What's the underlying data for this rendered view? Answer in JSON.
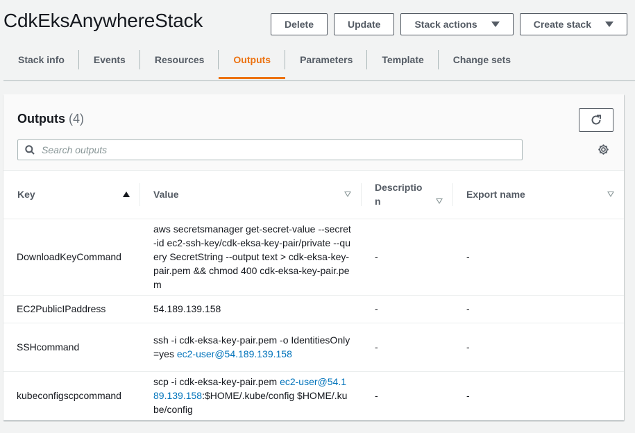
{
  "stack": {
    "title": "CdkEksAnywhereStack"
  },
  "actions": {
    "delete": "Delete",
    "update": "Update",
    "stack_actions": "Stack actions",
    "create_stack": "Create stack"
  },
  "tabs": [
    "Stack info",
    "Events",
    "Resources",
    "Outputs",
    "Parameters",
    "Template",
    "Change sets"
  ],
  "active_tab": "Outputs",
  "outputs": {
    "title": "Outputs",
    "count": "(4)",
    "search_placeholder": "Search outputs",
    "columns": {
      "key": "Key",
      "value": "Value",
      "description": "Description",
      "export": "Export name"
    },
    "rows": [
      {
        "key": "DownloadKeyCommand",
        "value": "aws secretsmanager get-secret-value --secret-id ec2-ssh-key/cdk-eksa-key-pair/private --query SecretString --output text > cdk-eksa-key-pair.pem && chmod 400 cdk-eksa-key-pair.pem",
        "description": "-",
        "export": "-"
      },
      {
        "key": "EC2PublicIPaddress",
        "value": "54.189.139.158",
        "description": "-",
        "export": "-"
      },
      {
        "key": "SSHcommand",
        "value_pre": "ssh -i cdk-eksa-key-pair.pem -o IdentitiesOnly=yes ",
        "value_link": "ec2-user@54.189.139.158",
        "value_post": "",
        "description": "-",
        "export": "-"
      },
      {
        "key": "kubeconfigscpcommand",
        "value_pre": "scp -i cdk-eksa-key-pair.pem ",
        "value_link": "ec2-user@54.189.139.158",
        "value_post": ":$HOME/.kube/config $HOME/.kube/config",
        "description": "-",
        "export": "-"
      }
    ]
  },
  "colors": {
    "accent": "#ec7211",
    "link": "#0073bb",
    "text": "#16191f",
    "muted": "#545b64"
  },
  "icons": {
    "refresh": "refresh-icon",
    "search": "search-icon",
    "settings": "gear-icon",
    "caret": "caret-down-icon"
  }
}
